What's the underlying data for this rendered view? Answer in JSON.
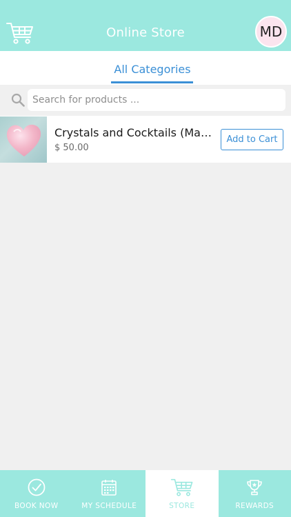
{
  "header": {
    "title": "Online Store",
    "avatar_initials": "MD",
    "cart_icon": "cart-icon"
  },
  "tabs": {
    "active_label": "All Categories"
  },
  "search": {
    "placeholder": "Search for products ...",
    "value": "",
    "icon": "search-icon"
  },
  "products": [
    {
      "name": "Crystals and Cocktails (Mar ...",
      "price": "$ 50.00",
      "button_label": "Add to Cart",
      "image": "pink-heart-crystal"
    }
  ],
  "bottom_nav": {
    "items": [
      {
        "label": "BOOK NOW",
        "icon": "checkmark-circle-icon",
        "active": false
      },
      {
        "label": "MY SCHEDULE",
        "icon": "calendar-icon",
        "active": false
      },
      {
        "label": "STORE",
        "icon": "cart-icon",
        "active": true
      },
      {
        "label": "REWARDS",
        "icon": "trophy-icon",
        "active": false
      }
    ]
  },
  "colors": {
    "header_bg": "#9be8df",
    "accent_blue": "#3a8fd6",
    "page_bg": "#f0f0f0",
    "avatar_bg": "#fbe4ee"
  }
}
